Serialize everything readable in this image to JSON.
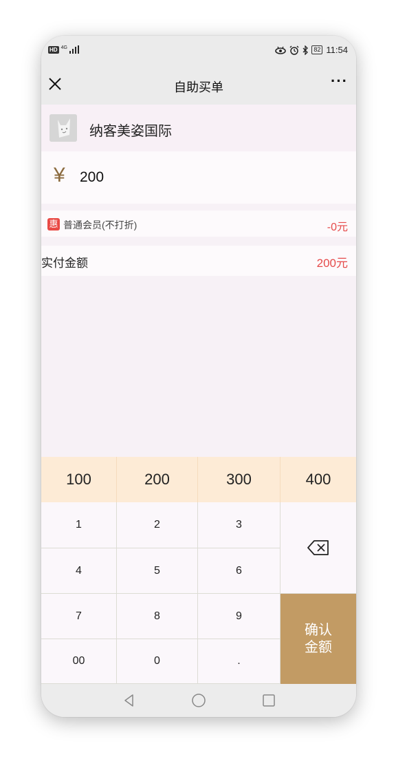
{
  "status_bar": {
    "left_badge": "HD",
    "signal_label": "4G",
    "battery": "82",
    "time": "11:54",
    "icons": [
      "eye-icon",
      "alarm-icon",
      "bluetooth-icon"
    ]
  },
  "nav": {
    "title": "自助买单",
    "more_label": "···"
  },
  "store": {
    "name": "纳客美姿国际"
  },
  "amount": {
    "currency": "¥",
    "value": "200"
  },
  "member": {
    "badge": "惠",
    "label": "普通会员(不打折)",
    "discount": "-0元"
  },
  "payment": {
    "label": "实付金额",
    "value": "200元"
  },
  "quick_amounts": [
    "100",
    "200",
    "300",
    "400"
  ],
  "keys": {
    "k1": "1",
    "k2": "2",
    "k3": "3",
    "k4": "4",
    "k5": "5",
    "k6": "6",
    "k7": "7",
    "k8": "8",
    "k9": "9",
    "k00": "00",
    "k0": "0",
    "kdot": "."
  },
  "confirm": {
    "line1": "确认",
    "line2": "金额"
  },
  "colors": {
    "accent": "#c29b64",
    "price_red": "#e54a4a",
    "quick_bg": "#fdebd6"
  }
}
